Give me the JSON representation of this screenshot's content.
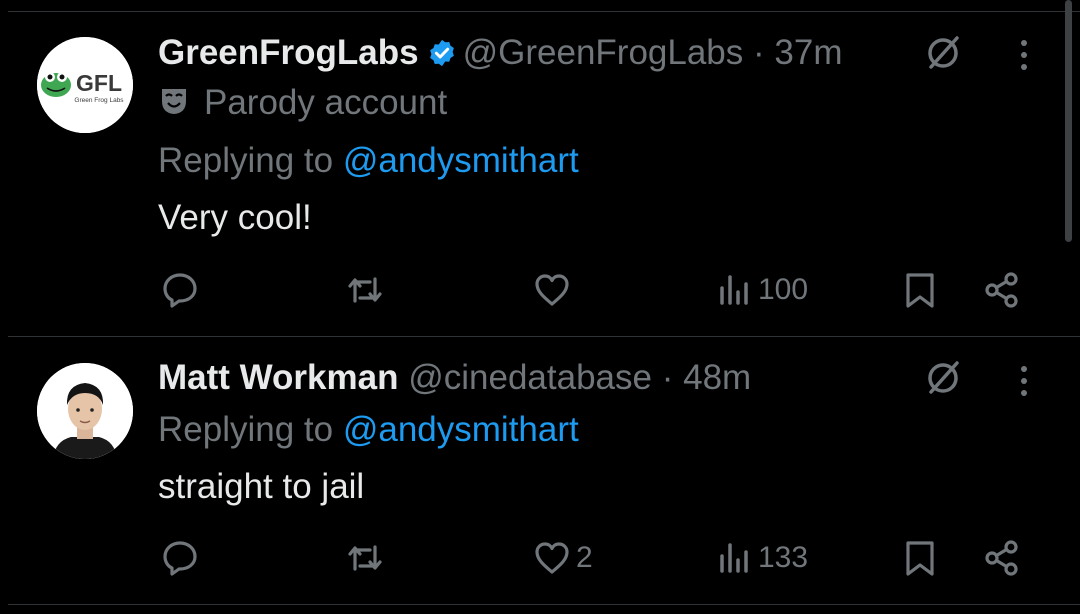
{
  "colors": {
    "background": "#000000",
    "primary_text": "#e7e9ea",
    "secondary_text": "#71767b",
    "accent": "#1d9bf0",
    "divider": "#2f3336"
  },
  "tweets": [
    {
      "avatar": {
        "text": "GFL",
        "subtext": "Green Frog Labs"
      },
      "display_name": "GreenFrogLabs",
      "verified": true,
      "handle": "@GreenFrogLabs",
      "separator": "·",
      "time": "37m",
      "label": "Parody account",
      "replying_prefix": "Replying to",
      "replying_to": "@andysmithart",
      "text": "Very cool!",
      "actions": {
        "replies": "",
        "reposts": "",
        "likes": "",
        "views": "100"
      }
    },
    {
      "avatar": {
        "text": "",
        "subtext": ""
      },
      "display_name": "Matt Workman",
      "verified": false,
      "handle": "@cinedatabase",
      "separator": "·",
      "time": "48m",
      "label": "",
      "replying_prefix": "Replying to",
      "replying_to": "@andysmithart",
      "text": "straight to jail",
      "actions": {
        "replies": "",
        "reposts": "",
        "likes": "2",
        "views": "133"
      }
    }
  ]
}
